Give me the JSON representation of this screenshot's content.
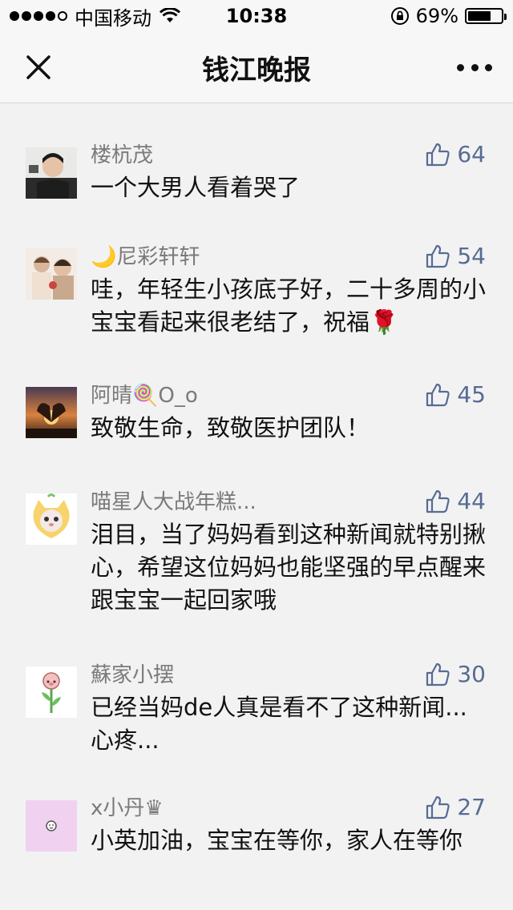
{
  "status_bar": {
    "carrier": "中国移动",
    "time": "10:38",
    "battery_percent": "69%",
    "battery_level": 0.69,
    "signal_bars": 4,
    "signal_total": 5
  },
  "nav": {
    "title": "钱江晚报",
    "close_icon": "close-icon",
    "more_icon": "more-icon"
  },
  "colors": {
    "like_blue": "#576b95",
    "name_gray": "#7a7a7a",
    "background": "#f2f2f2"
  },
  "comments": [
    {
      "name": "楼杭茂",
      "text": "一个大男人看着哭了",
      "likes": "64"
    },
    {
      "name": "🌙尼彩轩轩",
      "text": "哇，年轻生小孩底子好，二十多周的小宝宝看起来很老结了，祝福🌹",
      "likes": "54"
    },
    {
      "name": "阿晴🍭O_o",
      "text": "致敬生命，致敬医护团队！",
      "likes": "45"
    },
    {
      "name": "喵星人大战年糕...",
      "text": "泪目，当了妈妈看到这种新闻就特别揪心，希望这位妈妈也能坚强的早点醒来跟宝宝一起回家哦",
      "likes": "44"
    },
    {
      "name": "蘇家小摆",
      "text": "已经当妈de人真是看不了这种新闻...心疼...",
      "likes": "30"
    },
    {
      "name": "x小丹♛",
      "text": "小英加油，宝宝在等你，家人在等你",
      "likes": "27"
    }
  ]
}
